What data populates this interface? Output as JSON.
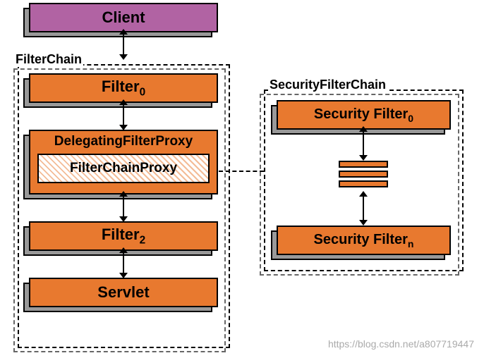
{
  "left": {
    "client": "Client",
    "container_label": "FilterChain",
    "filter0": "Filter",
    "filter0_sub": "0",
    "delegating": "DelegatingFilterProxy",
    "fcp": "FilterChainProxy",
    "filter2": "Filter",
    "filter2_sub": "2",
    "servlet": "Servlet"
  },
  "right": {
    "container_label": "SecurityFilterChain",
    "sec0": "Security Filter",
    "sec0_sub": "0",
    "secn": "Security Filter",
    "secn_sub": "n"
  },
  "watermark": "https://blog.csdn.net/a807719447"
}
